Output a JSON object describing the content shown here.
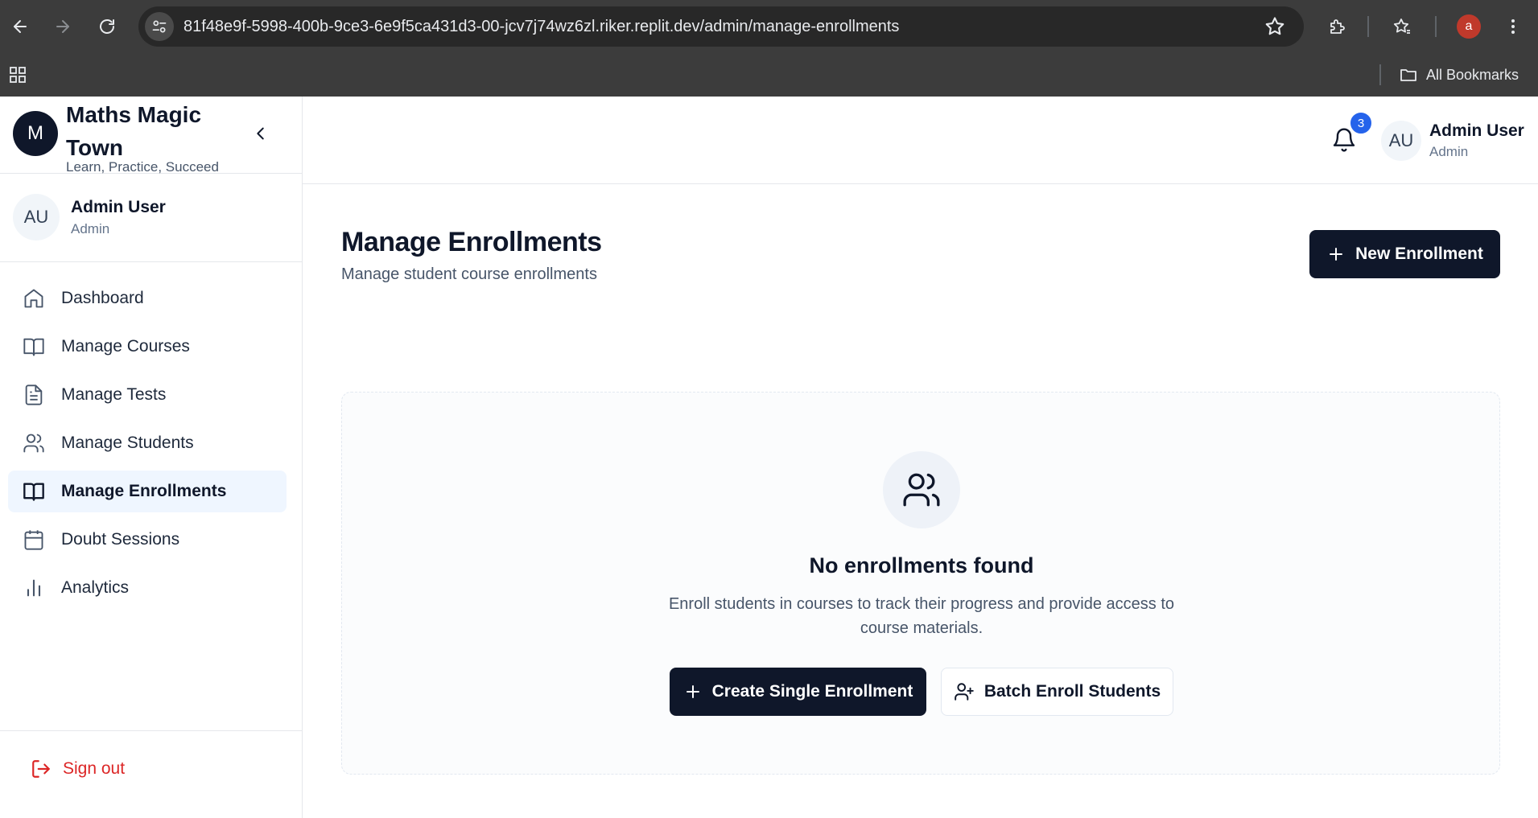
{
  "browser": {
    "url": "81f48e9f-5998-400b-9ce3-6e9f5ca431d3-00-jcv7j74wz6zl.riker.replit.dev/admin/manage-enrollments",
    "bookmarks_label": "All Bookmarks",
    "profile_initial": "a"
  },
  "sidebar": {
    "brand": {
      "logo_letter": "M",
      "name": "Maths Magic Town",
      "tagline": "Learn, Practice, Succeed"
    },
    "user": {
      "initials": "AU",
      "name": "Admin User",
      "role": "Admin"
    },
    "nav": [
      {
        "label": "Dashboard",
        "icon": "home-icon",
        "active": false
      },
      {
        "label": "Manage Courses",
        "icon": "book-open-icon",
        "active": false
      },
      {
        "label": "Manage Tests",
        "icon": "file-text-icon",
        "active": false
      },
      {
        "label": "Manage Students",
        "icon": "users-icon",
        "active": false
      },
      {
        "label": "Manage Enrollments",
        "icon": "book-open-icon",
        "active": true
      },
      {
        "label": "Doubt Sessions",
        "icon": "calendar-icon",
        "active": false
      },
      {
        "label": "Analytics",
        "icon": "bar-chart-icon",
        "active": false
      }
    ],
    "sign_out_label": "Sign out"
  },
  "topbar": {
    "notification_count": "3",
    "user": {
      "initials": "AU",
      "name": "Admin User",
      "role": "Admin"
    }
  },
  "main": {
    "title": "Manage Enrollments",
    "subtitle": "Manage student course enrollments",
    "new_button_label": "New Enrollment",
    "empty_state": {
      "icon": "users-icon",
      "title": "No enrollments found",
      "description": "Enroll students in courses to track their progress and provide access to course materials.",
      "primary_button_label": "Create Single Enrollment",
      "secondary_button_label": "Batch Enroll Students"
    }
  },
  "colors": {
    "primary": "#0f172a",
    "active_nav_bg": "#eff6ff",
    "danger": "#dc2626",
    "badge": "#2563eb"
  }
}
